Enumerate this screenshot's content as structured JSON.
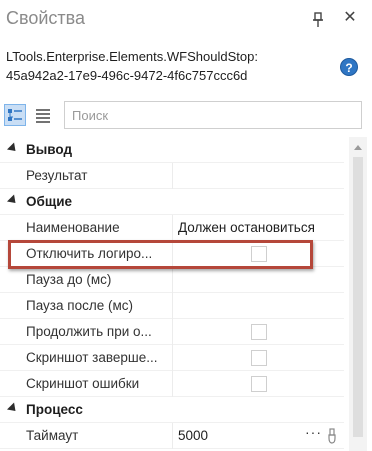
{
  "panel": {
    "title": "Свойства",
    "pin_icon": "pin-icon",
    "close_icon": "close-icon",
    "close_glyph": "✕"
  },
  "element": {
    "name_line1": "LTools.Enterprise.Elements.WFShouldStop:",
    "name_line2": "45a942a2-17e9-496c-9472-4f6c757ccc6d",
    "help_glyph": "?"
  },
  "toolbar": {
    "categorized_icon": "categorized-view-icon",
    "alphabetical_icon": "alphabetical-view-icon",
    "search_placeholder": "Поиск"
  },
  "grid": {
    "categories": [
      {
        "label": "Вывод"
      },
      {
        "label": "Общие"
      },
      {
        "label": "Процесс"
      }
    ],
    "rows": [
      {
        "name": "Результат",
        "value": ""
      },
      {
        "name": "Наименование",
        "value": "Должен остановиться"
      },
      {
        "name": "Отключить логиро...",
        "value": "",
        "checked": false
      },
      {
        "name": "Пауза до (мс)",
        "value": ""
      },
      {
        "name": "Пауза после (мс)",
        "value": ""
      },
      {
        "name": "Продолжить при о...",
        "value": "",
        "checked": false
      },
      {
        "name": "Скриншот заверше...",
        "value": "",
        "checked": false
      },
      {
        "name": "Скриншот ошибки",
        "value": "",
        "checked": false
      },
      {
        "name": "Таймаут",
        "value": "5000",
        "ellipsis": "···"
      }
    ]
  },
  "colors": {
    "highlight": "#b5473a",
    "accent": "#2f76c4"
  }
}
